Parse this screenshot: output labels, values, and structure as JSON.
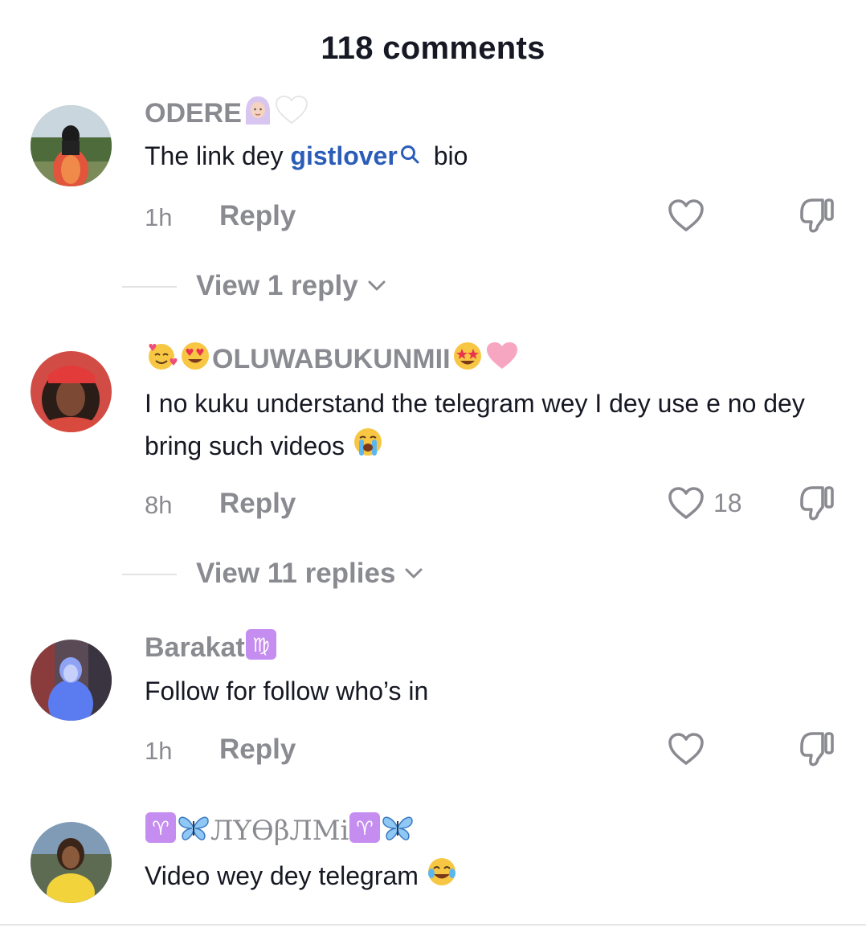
{
  "header": {
    "title": "118 comments"
  },
  "comments": [
    {
      "username": "ODERE",
      "badges": [
        "person-headscarf-icon",
        "white-heart-icon"
      ],
      "text_before": "The link dey ",
      "mention": "gistlover",
      "text_after": " bio",
      "time": "1h",
      "reply_label": "Reply",
      "likes": "",
      "view_replies": "View 1 reply"
    },
    {
      "username": "OLUWABUKUNMII",
      "badges_before": [
        "smiling-face-hearts-icon",
        "heart-eyes-icon"
      ],
      "badges": [
        "star-struck-icon",
        "pink-heart-icon"
      ],
      "text": "I no kuku understand the telegram wey I dey use e no dey bring such videos",
      "text_emoji": "loudly-crying-face-icon",
      "time": "8h",
      "reply_label": "Reply",
      "likes": "18",
      "view_replies": "View 11 replies"
    },
    {
      "username": "Barakat",
      "badges": [
        "virgo-icon"
      ],
      "text": "Follow for follow who’s in",
      "time": "1h",
      "reply_label": "Reply",
      "likes": ""
    },
    {
      "username": "ЛYϴβЛMi",
      "badges_before": [
        "aries-icon",
        "butterfly-icon"
      ],
      "badges": [
        "aries-icon",
        "butterfly-icon"
      ],
      "text": "Video wey dey telegram",
      "text_emoji": "face-tears-of-joy-icon"
    }
  ],
  "colors": {
    "text": "#161823",
    "muted": "#8a8b91",
    "mention": "#2b5db8",
    "divider": "#e3e3e4"
  }
}
